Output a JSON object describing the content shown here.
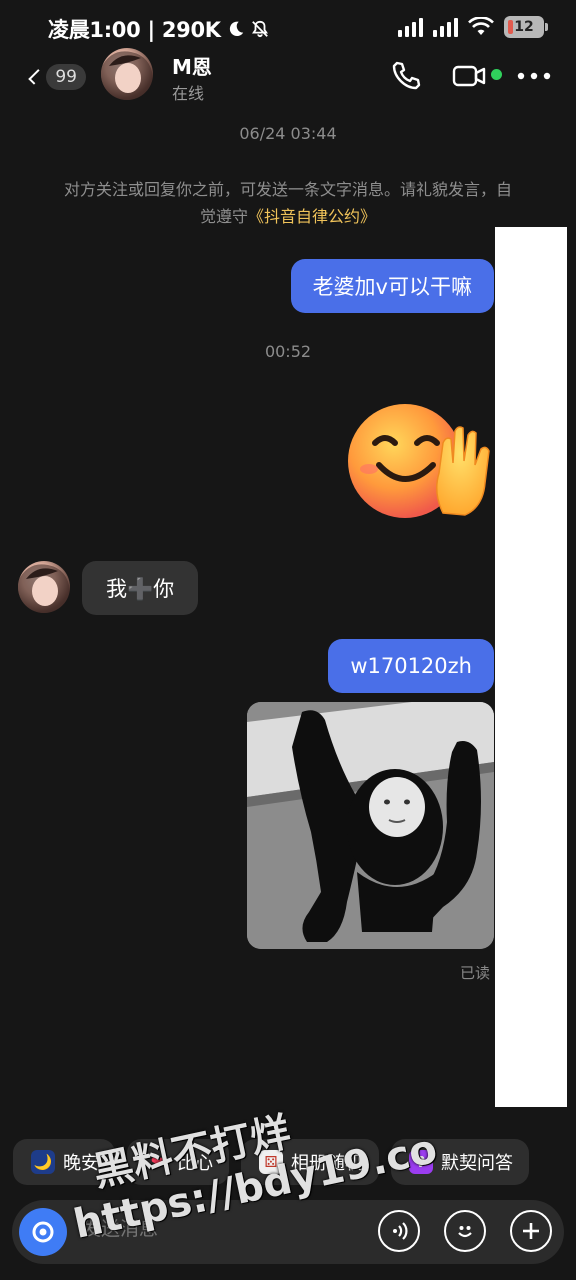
{
  "status_bar": {
    "time_text": "凌晨1:00 | 290K",
    "battery": "12"
  },
  "header": {
    "back_badge": "99",
    "contact_name": "M恩",
    "contact_status": "在线"
  },
  "chat": {
    "timestamp_1": "06/24 03:44",
    "notice_text": "对方关注或回复你之前，可发送一条文字消息。请礼貌发言，自觉遵守",
    "notice_link": "《抖音自律公约》",
    "msg_out_1": "老婆加v可以干嘛",
    "timestamp_2": "00:52",
    "msg_in_1": "我➕你",
    "msg_out_2": "w170120zh",
    "read_status": "已读"
  },
  "quick_replies": [
    {
      "label": "晚安",
      "icon": "moon-icon"
    },
    {
      "label": "比心",
      "icon": "heart-icon"
    },
    {
      "label": "相册随机",
      "icon": "dice-icon"
    },
    {
      "label": "默契问答",
      "icon": "question-icon"
    }
  ],
  "input": {
    "placeholder": "发送消息"
  },
  "watermark": {
    "line1": "黑料不打烊",
    "line2": "https://bdy19.co"
  },
  "colors": {
    "background": "#161616",
    "outgoing_bubble": "#4a6fe8",
    "incoming_bubble": "#333333",
    "link": "#f0c35a",
    "online": "#30d15c"
  }
}
